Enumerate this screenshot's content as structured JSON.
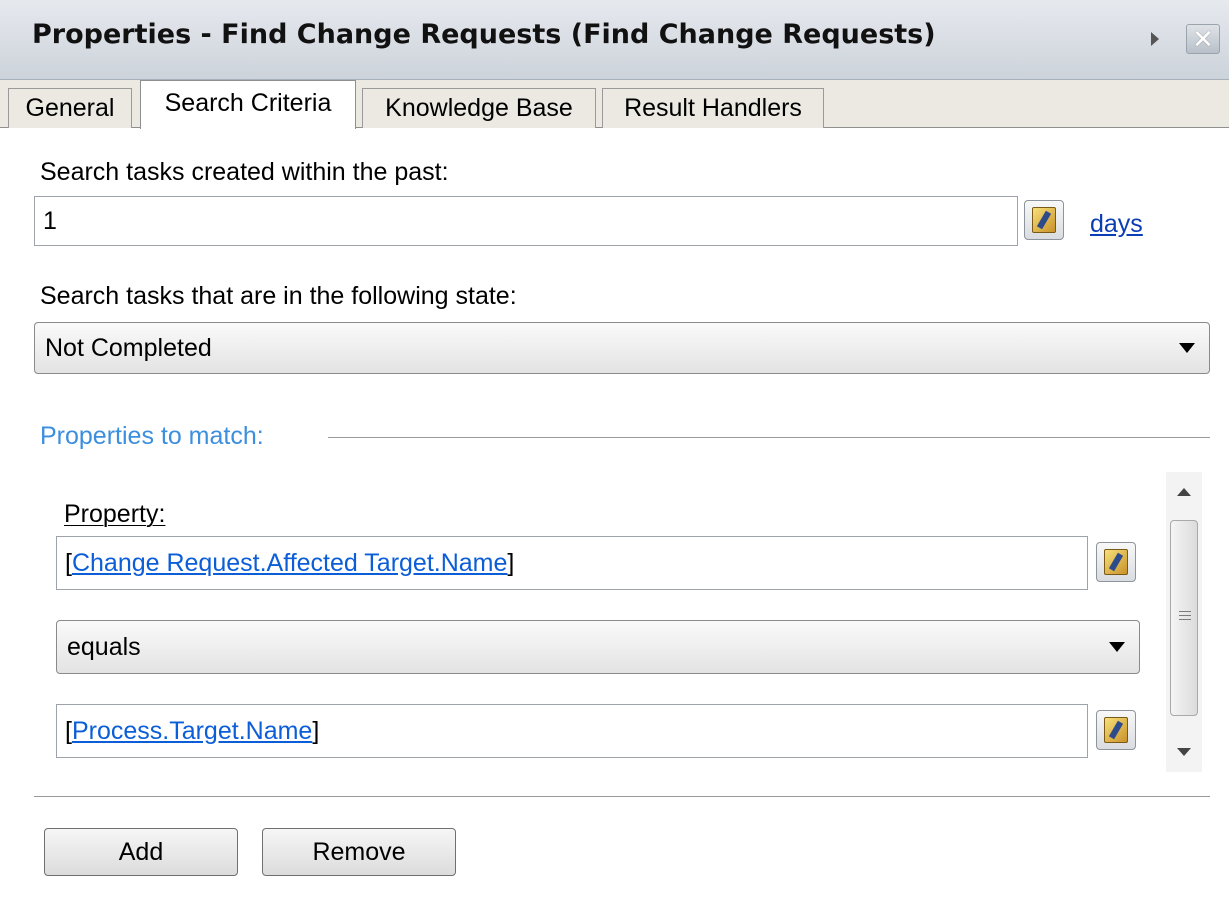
{
  "window": {
    "title": "Properties - Find Change Requests (Find Change Requests)"
  },
  "tabs": [
    {
      "label": "General",
      "active": false
    },
    {
      "label": "Search Criteria",
      "active": true
    },
    {
      "label": "Knowledge Base",
      "active": false
    },
    {
      "label": "Result Handlers",
      "active": false
    }
  ],
  "search_criteria": {
    "created_within_label": "Search tasks created within the past:",
    "created_within_value": "1",
    "unit_link": "days",
    "state_label": "Search tasks that are in the following state:",
    "state_value": "Not Completed"
  },
  "properties_to_match": {
    "group_label": "Properties to match:",
    "property_label": "Property:",
    "property_open": "[",
    "property_value": "Change Request.Affected Target.Name",
    "property_close": "]",
    "operator_value": "equals",
    "compare_open": "[",
    "compare_value": "Process.Target.Name",
    "compare_close": "]"
  },
  "buttons": {
    "add_label": "Add",
    "remove_label": "Remove"
  }
}
